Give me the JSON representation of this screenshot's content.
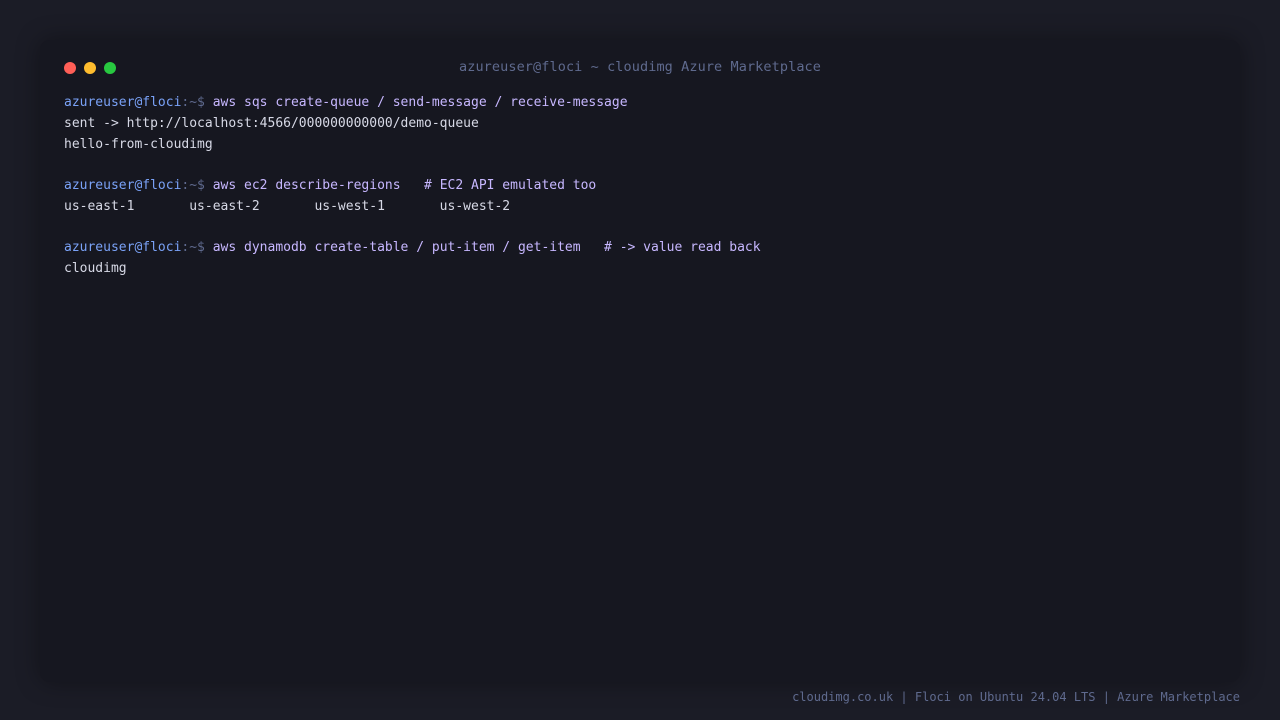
{
  "window": {
    "title": "azureuser@floci ~ cloudimg Azure Marketplace",
    "buttons": {
      "close_color": "#ff5f57",
      "minimize_color": "#febc2e",
      "maximize_color": "#28c840"
    }
  },
  "terminal": {
    "prompt_user": "azureuser@floci",
    "prompt_suffix": ":~$ ",
    "blocks": [
      {
        "command": "aws sqs create-queue / send-message / receive-message",
        "output": [
          "sent -> http://localhost:4566/000000000000/demo-queue",
          "hello-from-cloudimg"
        ]
      },
      {
        "command": "aws ec2 describe-regions   # EC2 API emulated too",
        "output": [
          "us-east-1       us-east-2       us-west-1       us-west-2"
        ]
      },
      {
        "command": "aws dynamodb create-table / put-item / get-item   # -> value read back",
        "output": [
          "cloudimg"
        ]
      }
    ]
  },
  "footer": {
    "text": "cloudimg.co.uk | Floci on Ubuntu 24.04 LTS | Azure Marketplace"
  },
  "colors": {
    "background": "#1b1c26",
    "terminal_bg": "#161720",
    "prompt_user": "#7aa2f7",
    "command": "#c7b7ff",
    "output": "#d7d9e6",
    "muted": "#5f6a8e"
  }
}
